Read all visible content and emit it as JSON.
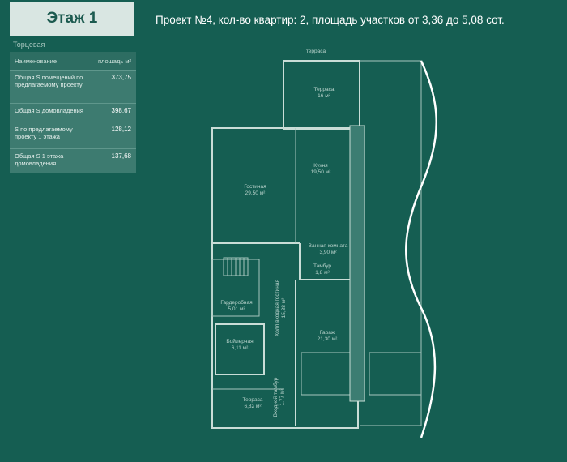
{
  "floor_tab": "Этаж 1",
  "project_title": "Проект №4, кол-во квартир: 2, площадь участков от 3,36 до 5,08 сот.",
  "section_label": "Торцевая",
  "table": {
    "col_name": "Наименование",
    "col_area": "площадь м²",
    "rows": [
      {
        "name": "Общая S помещений по предлагаемому проекту",
        "value": "373,75"
      },
      {
        "name": "Общая S домовладения",
        "value": "398,67"
      },
      {
        "name": "S по предлагаемому проекту 1 этажа",
        "value": "128,12"
      },
      {
        "name": "Общая S 1 этажа домовладения",
        "value": "137,68"
      }
    ]
  },
  "plan": {
    "top_label": "терраса",
    "rooms": {
      "terrace_top": {
        "name": "Терраса",
        "area": "16 м²"
      },
      "kitchen": {
        "name": "Кухня",
        "area": "19,50 м²"
      },
      "living": {
        "name": "Гостиная",
        "area": "29,50 м²"
      },
      "bathroom": {
        "name": "Ванная комната",
        "area": "3,90 м²"
      },
      "vestibule_small": {
        "name": "Тамбур",
        "area": "1,8 м²"
      },
      "hall": {
        "name": "Холл входная гостиная",
        "area": "15,38 м²"
      },
      "wardrobe": {
        "name": "Гардеробная",
        "area": "5,01 м²"
      },
      "boiler": {
        "name": "Бойлерная",
        "area": "6,11 м²"
      },
      "garage": {
        "name": "Гараж",
        "area": "21,30 м²"
      },
      "entrance_vestibule": {
        "name": "Входной тамбур",
        "area": "1,77 м²"
      },
      "terrace_bottom": {
        "name": "Терраса",
        "area": "6,82 м²"
      }
    }
  }
}
